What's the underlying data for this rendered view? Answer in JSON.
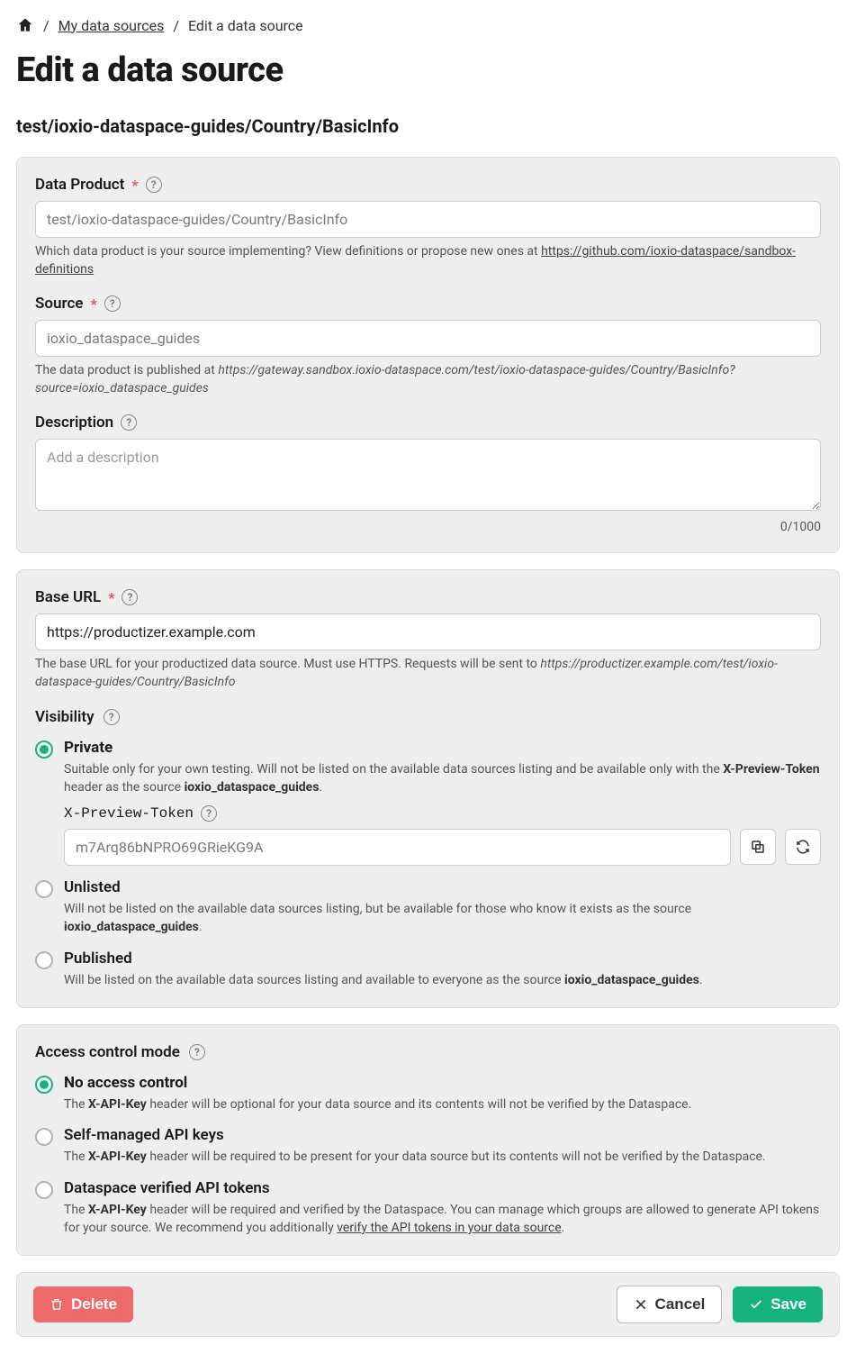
{
  "breadcrumb": {
    "home": "Home",
    "my_sources": "My data sources",
    "current": "Edit a data source"
  },
  "page_title": "Edit a data source",
  "subtitle": "test/ioxio-dataspace-guides/Country/BasicInfo",
  "fields": {
    "data_product": {
      "label": "Data Product",
      "value": "test/ioxio-dataspace-guides/Country/BasicInfo",
      "hint_pre": "Which data product is your source implementing? View definitions or propose new ones at ",
      "hint_link": "https://github.com/ioxio-dataspace/sandbox-definitions"
    },
    "source": {
      "label": "Source",
      "value": "ioxio_dataspace_guides",
      "hint_pre": "The data product is published at ",
      "hint_ital": "https://gateway.sandbox.ioxio-dataspace.com/test/ioxio-dataspace-guides/Country/BasicInfo?source=ioxio_dataspace_guides"
    },
    "description": {
      "label": "Description",
      "placeholder": "Add a description",
      "counter": "0/1000"
    },
    "base_url": {
      "label": "Base URL",
      "value": "https://productizer.example.com",
      "hint_pre": "The base URL for your productized data source. Must use HTTPS. Requests will be sent to ",
      "hint_ital": "https://productizer.example.com/test/ioxio-dataspace-guides/Country/BasicInfo"
    }
  },
  "visibility": {
    "label": "Visibility",
    "options": {
      "private": {
        "title": "Private",
        "desc_pre": "Suitable only for your own testing. Will not be listed on the available data sources listing and be available only with the ",
        "desc_bold1": "X-Preview-Token",
        "desc_mid": " header as the source ",
        "desc_bold2": "ioxio_dataspace_guides",
        "desc_post": ".",
        "token_label": "X-Preview-Token",
        "token_value": "m7Arq86bNPRO69GRieKG9A"
      },
      "unlisted": {
        "title": "Unlisted",
        "desc_pre": "Will not be listed on the available data sources listing, but be available for those who know it exists as the source ",
        "desc_bold": "ioxio_dataspace_guides",
        "desc_post": "."
      },
      "published": {
        "title": "Published",
        "desc_pre": "Will be listed on the available data sources listing and available to everyone as the source ",
        "desc_bold": "ioxio_dataspace_guides",
        "desc_post": "."
      }
    }
  },
  "access": {
    "label": "Access control mode",
    "options": {
      "none": {
        "title": "No access control",
        "desc_pre": "The ",
        "desc_bold": "X-API-Key",
        "desc_post": " header will be optional for your data source and its contents will not be verified by the Dataspace."
      },
      "self": {
        "title": "Self-managed API keys",
        "desc_pre": "The ",
        "desc_bold": "X-API-Key",
        "desc_post": " header will be required to be present for your data source but its contents will not be verified by the Dataspace."
      },
      "verified": {
        "title": "Dataspace verified API tokens",
        "desc_pre": "The ",
        "desc_bold": "X-API-Key",
        "desc_mid": " header will be required and verified by the Dataspace. You can manage which groups are allowed to generate API tokens for your source. We recommend you additionally ",
        "desc_link": "verify the API tokens in your data source",
        "desc_post": "."
      }
    }
  },
  "buttons": {
    "delete": "Delete",
    "cancel": "Cancel",
    "save": "Save"
  }
}
